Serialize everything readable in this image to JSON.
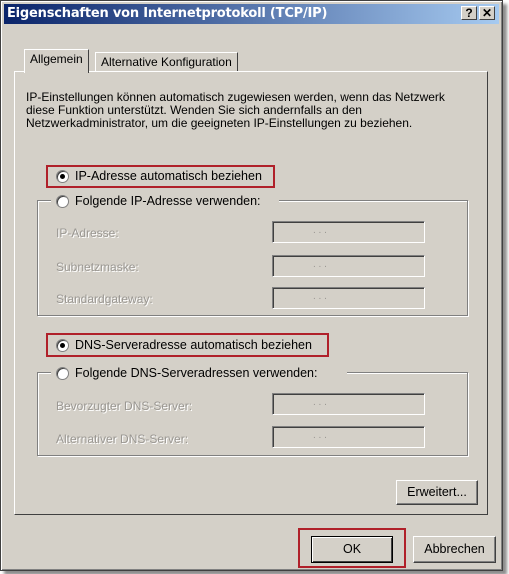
{
  "window": {
    "title": "Eigenschaften von Internetprotokoll (TCP/IP)",
    "help_label": "?",
    "close_label": "✕"
  },
  "tabs": [
    {
      "label": "Allgemein",
      "active": true
    },
    {
      "label": "Alternative Konfiguration",
      "active": false
    }
  ],
  "description": "IP-Einstellungen können automatisch zugewiesen werden, wenn das Netzwerk diese Funktion unterstützt. Wenden Sie sich andernfalls an den Netzwerkadministrator, um die geeigneten IP-Einstellungen zu beziehen.",
  "ip": {
    "auto_label": "IP-Adresse automatisch beziehen",
    "auto_selected": true,
    "manual_label": "Folgende IP-Adresse verwenden:",
    "manual_selected": false,
    "fields": [
      {
        "label": "IP-Adresse:",
        "value": ".   .   ."
      },
      {
        "label": "Subnetzmaske:",
        "value": ".   .   ."
      },
      {
        "label": "Standardgateway:",
        "value": ".   .   ."
      }
    ]
  },
  "dns": {
    "auto_label": "DNS-Serveradresse automatisch beziehen",
    "auto_selected": true,
    "manual_label": "Folgende DNS-Serveradressen verwenden:",
    "manual_selected": false,
    "fields": [
      {
        "label": "Bevorzugter DNS-Server:",
        "value": ".   .   ."
      },
      {
        "label": "Alternativer DNS-Server:",
        "value": ".   .   ."
      }
    ]
  },
  "buttons": {
    "advanced": "Erweitert...",
    "ok": "OK",
    "cancel": "Abbrechen"
  },
  "colors": {
    "highlight": "#b0202a",
    "title_start": "#0a246a",
    "title_end": "#a6caf0"
  }
}
